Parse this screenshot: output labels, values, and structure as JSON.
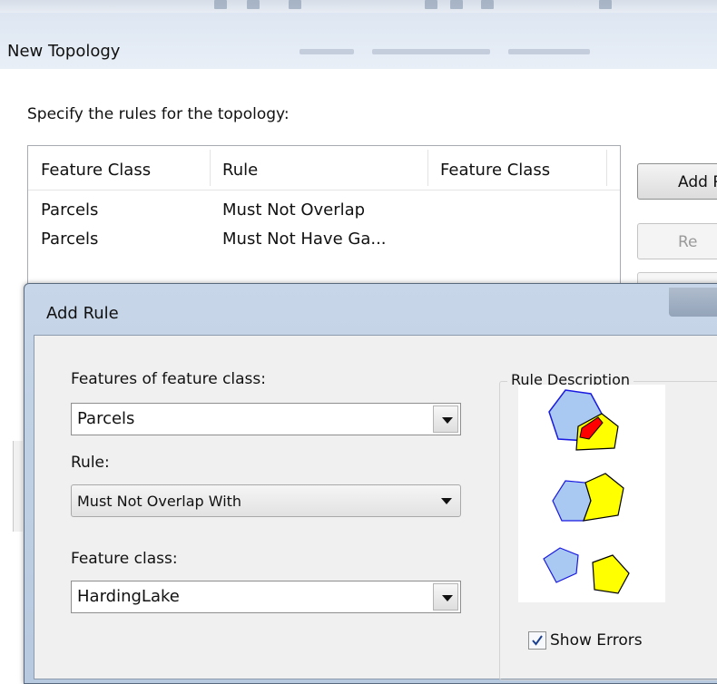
{
  "window": {
    "title": "New Topology",
    "instruction": "Specify the rules for the topology:"
  },
  "rules_list": {
    "columns": [
      "Feature Class",
      "Rule",
      "Feature Class"
    ],
    "rows": [
      {
        "feature_class": "Parcels",
        "rule": "Must Not Overlap",
        "feature_class_2": ""
      },
      {
        "feature_class": "Parcels",
        "rule": "Must Not Have Ga...",
        "feature_class_2": ""
      }
    ]
  },
  "side_buttons": {
    "add_label": "Add R",
    "remove_label": "Re"
  },
  "add_rule_dialog": {
    "title": "Add Rule",
    "features_label": "Features of feature class:",
    "features_value": "Parcels",
    "rule_label": "Rule:",
    "rule_value": "Must Not Overlap With",
    "feature_class_label": "Feature class:",
    "feature_class_value": "HardingLake",
    "rule_description_legend": "Rule Description",
    "show_errors_label": "Show Errors",
    "show_errors_checked": true
  },
  "colors": {
    "polygon_blue": "#a9c9f2",
    "polygon_yellow": "#ffff00",
    "error_red": "#ff0000",
    "dialog_frame": "#bfd0e4"
  }
}
